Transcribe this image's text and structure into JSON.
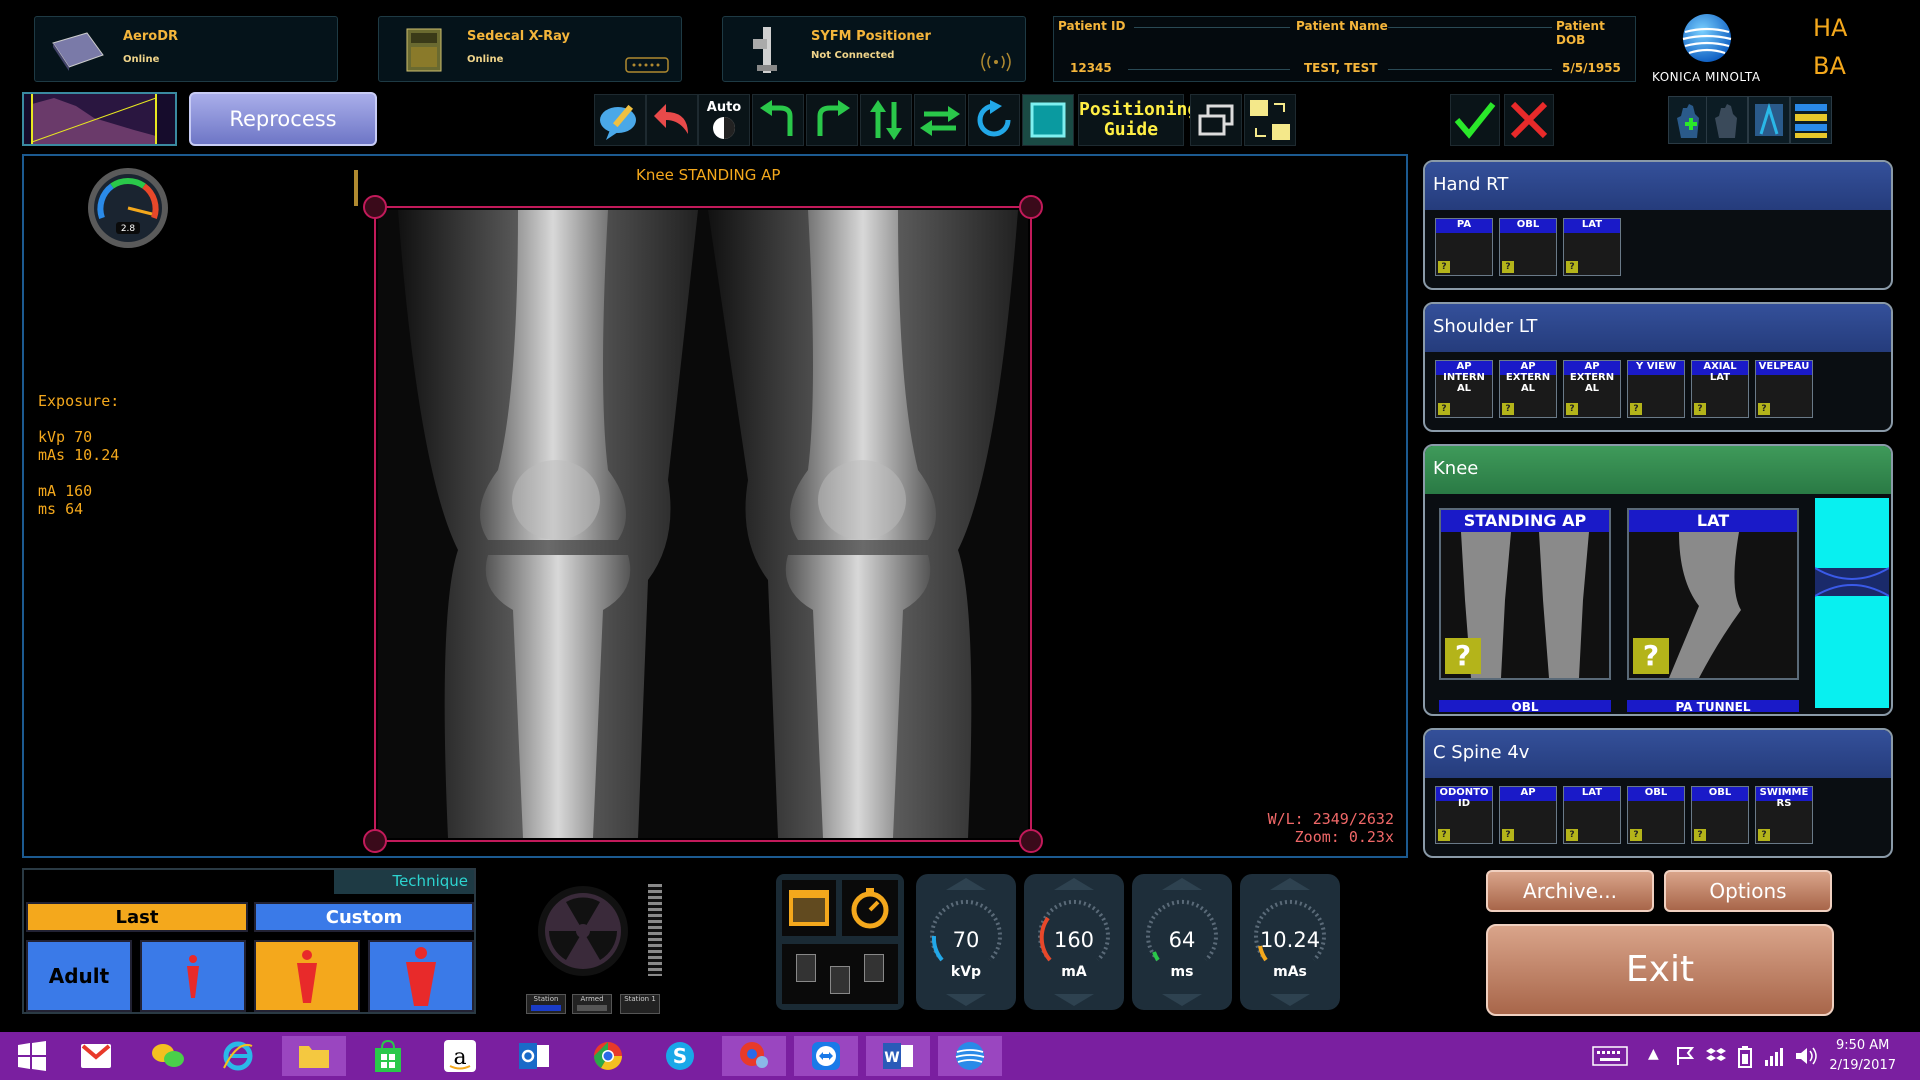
{
  "devices": [
    {
      "name": "AeroDR",
      "status": "Online"
    },
    {
      "name": "Sedecal X-Ray",
      "status": "Online"
    },
    {
      "name": "SYFM Positioner",
      "status": "Not Connected"
    }
  ],
  "patient": {
    "id_label": "Patient ID",
    "name_label": "Patient Name",
    "dob_label": "Patient DOB",
    "id": "12345",
    "name": "TEST, TEST",
    "dob": "5/5/1955"
  },
  "brand": {
    "name": "KONICA MINOLTA",
    "ha": "HA",
    "ba": "BA"
  },
  "toolbar": {
    "reprocess_label": "Reprocess",
    "auto_label": "Auto",
    "positioning_guide_label": "Positioning Guide"
  },
  "viewer": {
    "title": "Knee STANDING AP",
    "gauge_value": "2.8",
    "exposure_heading": "Exposure:",
    "kvp": "kVp 70",
    "mas": "mAs 10.24",
    "ma": "mA 160",
    "ms": "ms 64",
    "wl": "W/L: 2349/2632",
    "zoom": "Zoom: 0.23x"
  },
  "protocols": [
    {
      "title": "Hand RT",
      "views": [
        "PA",
        "OBL",
        "LAT"
      ]
    },
    {
      "title": "Shoulder LT",
      "views": [
        "AP INTERN AL",
        "AP EXTERN AL",
        "AP EXTERN AL",
        "Y VIEW",
        "AXIAL LAT",
        "VELPEAU"
      ]
    },
    {
      "title": "Knee",
      "views": [
        "STANDING AP",
        "LAT"
      ],
      "more": [
        "OBL",
        "PA TUNNEL"
      ]
    },
    {
      "title": "C Spine 4v",
      "views": [
        "ODONTO ID",
        "AP",
        "LAT",
        "OBL",
        "OBL",
        "SWIMME RS"
      ]
    }
  ],
  "thumb_q": "?",
  "technique": {
    "tab_label": "Technique",
    "last_label": "Last",
    "custom_label": "Custom",
    "adult_label": "Adult"
  },
  "mini_status": [
    "Station",
    "Armed",
    "Station 1"
  ],
  "dials": [
    {
      "value": "70",
      "unit": "kVp"
    },
    {
      "value": "160",
      "unit": "mA"
    },
    {
      "value": "64",
      "unit": "ms"
    },
    {
      "value": "10.24",
      "unit": "mAs"
    }
  ],
  "actions": {
    "archive_label": "Archive...",
    "options_label": "Options",
    "exit_label": "Exit"
  },
  "taskbar": {
    "time": "9:50 AM",
    "date": "2/19/2017"
  },
  "colors": {
    "accent": "#f4a81c",
    "crop": "#c21a5a",
    "taskbar": "#7a1fa0"
  }
}
